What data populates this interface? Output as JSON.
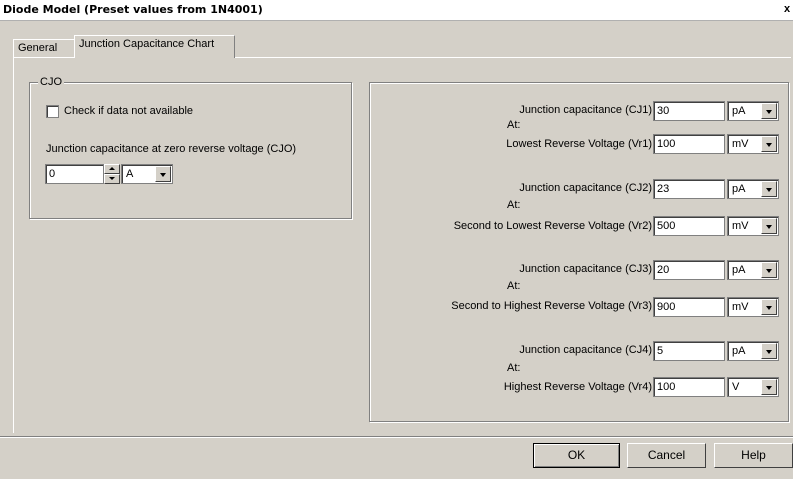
{
  "window": {
    "title": "Diode Model (Preset values from 1N4001)",
    "close_label": "x"
  },
  "tabs": [
    {
      "label": "General"
    },
    {
      "label": "Junction Capacitance Chart"
    }
  ],
  "cjo_group": {
    "legend": "CJO",
    "checkbox_label": "Check if data not available",
    "field_label": "Junction capacitance at zero reverse voltage (CJO)",
    "value": "0",
    "unit": "A"
  },
  "chart": {
    "at_label": "At:",
    "rows": [
      {
        "cap_label": "Junction capacitance (CJ1)",
        "cap_value": "30",
        "cap_unit": "pA",
        "volt_label": "Lowest Reverse Voltage (Vr1)",
        "volt_value": "100",
        "volt_unit": "mV"
      },
      {
        "cap_label": "Junction capacitance (CJ2)",
        "cap_value": "23",
        "cap_unit": "pA",
        "volt_label": "Second to Lowest Reverse Voltage  (Vr2)",
        "volt_value": "500",
        "volt_unit": "mV"
      },
      {
        "cap_label": "Junction capacitance (CJ3)",
        "cap_value": "20",
        "cap_unit": "pA",
        "volt_label": "Second to Highest Reverse Voltage (Vr3)",
        "volt_value": "900",
        "volt_unit": "mV"
      },
      {
        "cap_label": "Junction capacitance (CJ4)",
        "cap_value": "5",
        "cap_unit": "pA",
        "volt_label": "Highest Reverse Voltage (Vr4)",
        "volt_value": "100",
        "volt_unit": "V"
      }
    ]
  },
  "buttons": {
    "ok": "OK",
    "cancel": "Cancel",
    "help": "Help"
  }
}
